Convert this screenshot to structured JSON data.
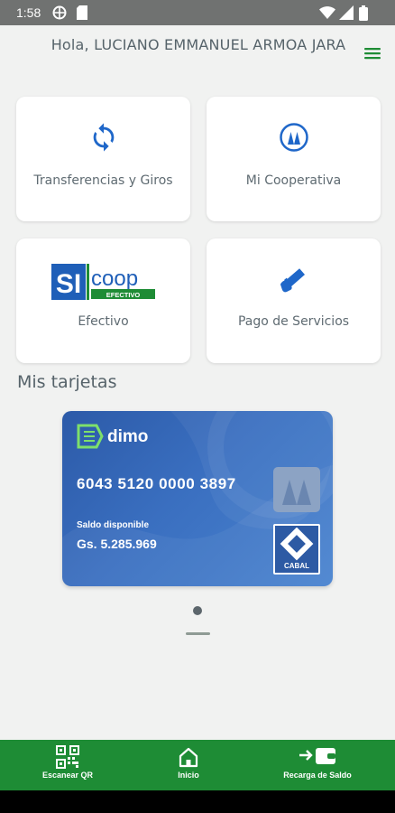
{
  "status_bar": {
    "time": "1:58"
  },
  "header": {
    "greeting": "Hola, LUCIANO EMMANUEL ARMOA JARA"
  },
  "tiles": [
    {
      "label": "Transferencias y Giros",
      "icon": "sync-icon"
    },
    {
      "label": "Mi Cooperativa",
      "icon": "cooperative-icon"
    },
    {
      "label": "Efectivo",
      "icon": "sicoop-logo"
    },
    {
      "label": "Pago de Servicios",
      "icon": "payment-card-icon"
    }
  ],
  "sicoop_logo": {
    "si": "SI",
    "coop": "coop",
    "efectivo": "EFECTIVO"
  },
  "section_title": "Mis tarjetas",
  "card": {
    "brand": "dimo",
    "number": "6043 5120 0000 3897",
    "balance_label": "Saldo disponible",
    "balance": "Gs. 5.285.969",
    "network": "CABAL"
  },
  "bottom_nav": [
    {
      "label": "Escanear QR",
      "icon": "qr-code-icon"
    },
    {
      "label": "Inicio",
      "icon": "home-icon"
    },
    {
      "label": "Recarga de Saldo",
      "icon": "wallet-recharge-icon"
    }
  ],
  "colors": {
    "primary_green": "#1e8c35",
    "accent_blue": "#1f67c9",
    "card_blue": "#3a6fc0"
  }
}
